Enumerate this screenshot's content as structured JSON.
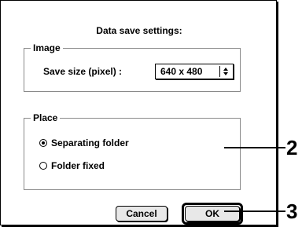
{
  "dialog": {
    "title": "Data save settings:",
    "image_group": {
      "label": "Image",
      "save_size_label": "Save size (pixel) :",
      "save_size_value": "640 x 480"
    },
    "place_group": {
      "label": "Place",
      "options": [
        {
          "label": "Separating folder",
          "selected": true
        },
        {
          "label": "Folder fixed",
          "selected": false
        }
      ]
    },
    "buttons": {
      "cancel": "Cancel",
      "ok": "OK"
    }
  },
  "callouts": {
    "place": "2",
    "ok": "3"
  }
}
